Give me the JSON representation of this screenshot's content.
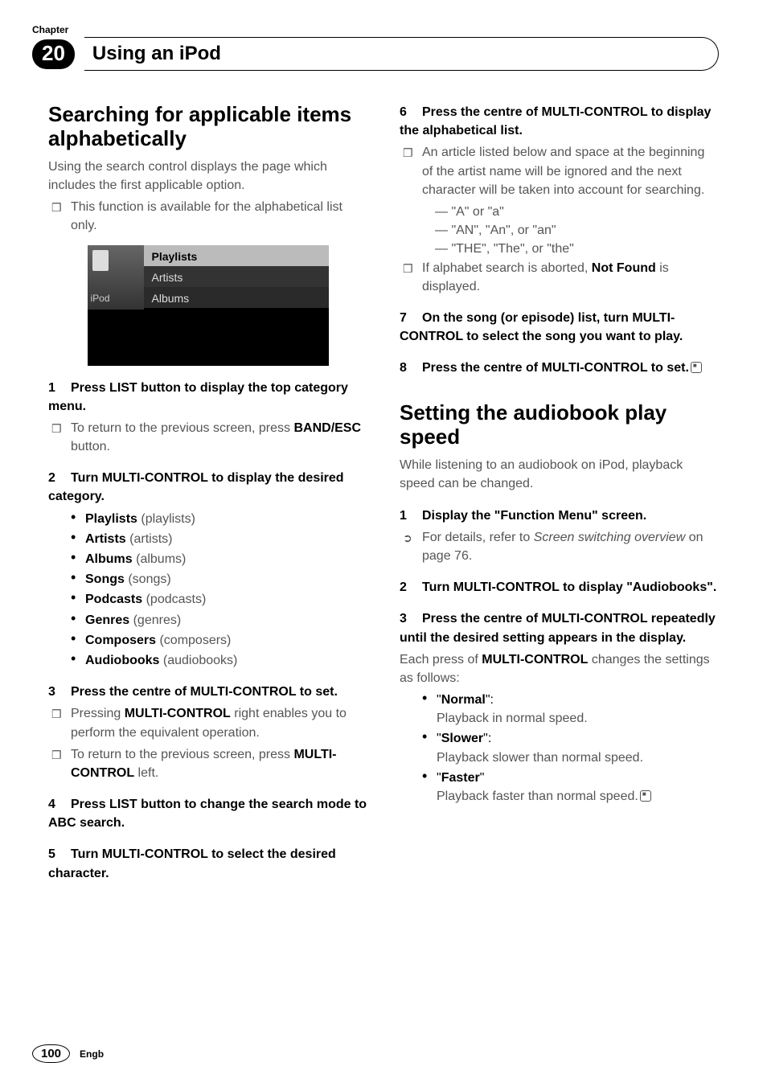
{
  "header": {
    "chapter_label": "Chapter",
    "chapter_number": "20",
    "chapter_title": "Using an iPod"
  },
  "left": {
    "h_search": "Searching for applicable items alphabetically",
    "intro": "Using the search control displays the page which includes the first applicable option.",
    "note_alpha": "This function is available for the alphabetical list only.",
    "screenshot": {
      "side_label": "iPod",
      "row1": "Playlists",
      "row2": "Artists",
      "row3": "Albums"
    },
    "step1": {
      "n": "1",
      "t": "Press LIST button to display the top category menu."
    },
    "step1_note_a_pre": "To return to the previous screen, press ",
    "step1_note_a_bold": "BAND/ESC",
    "step1_note_a_post": " button.",
    "step2": {
      "n": "2",
      "t": "Turn MULTI-CONTROL to display the desired category."
    },
    "cats": [
      {
        "b": "Playlists",
        "g": " (playlists)"
      },
      {
        "b": "Artists",
        "g": " (artists)"
      },
      {
        "b": "Albums",
        "g": " (albums)"
      },
      {
        "b": "Songs",
        "g": " (songs)"
      },
      {
        "b": "Podcasts",
        "g": " (podcasts)"
      },
      {
        "b": "Genres",
        "g": " (genres)"
      },
      {
        "b": "Composers",
        "g": " (composers)"
      },
      {
        "b": "Audiobooks",
        "g": " (audiobooks)"
      }
    ],
    "step3": {
      "n": "3",
      "t": "Press the centre of MULTI-CONTROL to set."
    },
    "step3_note_a_pre": "Pressing ",
    "step3_note_a_bold": "MULTI-CONTROL",
    "step3_note_a_post": " right enables you to perform the equivalent operation.",
    "step3_note_b_pre": "To return to the previous screen, press ",
    "step3_note_b_bold": "MULTI-CONTROL",
    "step3_note_b_post": " left.",
    "step4": {
      "n": "4",
      "t": "Press LIST button to change the search mode to ABC search."
    },
    "step5": {
      "n": "5",
      "t": "Turn MULTI-CONTROL to select the desired character."
    }
  },
  "right": {
    "step6": {
      "n": "6",
      "t": "Press the centre of MULTI-CONTROL to display the alphabetical list."
    },
    "step6_note": "An article listed below and space at the beginning of the artist name will be ignored and the next character will be taken into account for searching.",
    "step6_dash": [
      "\"A\" or \"a\"",
      "\"AN\", \"An\", or \"an\"",
      "\"THE\", \"The\", or \"the\""
    ],
    "step6_note2_pre": "If alphabet search is aborted, ",
    "step6_note2_bold": "Not Found",
    "step6_note2_post": " is displayed.",
    "step7": {
      "n": "7",
      "t": "On the song (or episode) list, turn MULTI-CONTROL to select the song you want to play."
    },
    "step8": {
      "n": "8",
      "t": "Press the centre of MULTI-CONTROL to set."
    },
    "h_audiobook": "Setting the audiobook play speed",
    "audiobook_intro": "While listening to an audiobook on iPod, playback speed can be changed.",
    "a_step1": {
      "n": "1",
      "t": "Display the \"Function Menu\" screen."
    },
    "a_step1_ref_pre": "For details, refer to ",
    "a_step1_ref_em": "Screen switching overview",
    "a_step1_ref_post": " on page 76.",
    "a_step2": {
      "n": "2",
      "t": "Turn MULTI-CONTROL to display \"Audiobooks\"."
    },
    "a_step3": {
      "n": "3",
      "t": "Press the centre of MULTI-CONTROL repeatedly until the desired setting appears in the display."
    },
    "a_step3_after_pre": "Each press of ",
    "a_step3_after_bold": "MULTI-CONTROL",
    "a_step3_after_post": " changes the settings as follows:",
    "speeds": [
      {
        "b": "Normal",
        "q": "\":",
        "d": "Playback in normal speed."
      },
      {
        "b": "Slower",
        "q": "\":",
        "d": "Playback slower than normal speed."
      },
      {
        "b": "Faster",
        "q": "\"",
        "d": "Playback faster than normal speed."
      }
    ]
  },
  "footer": {
    "page": "100",
    "lang": "Engb"
  }
}
